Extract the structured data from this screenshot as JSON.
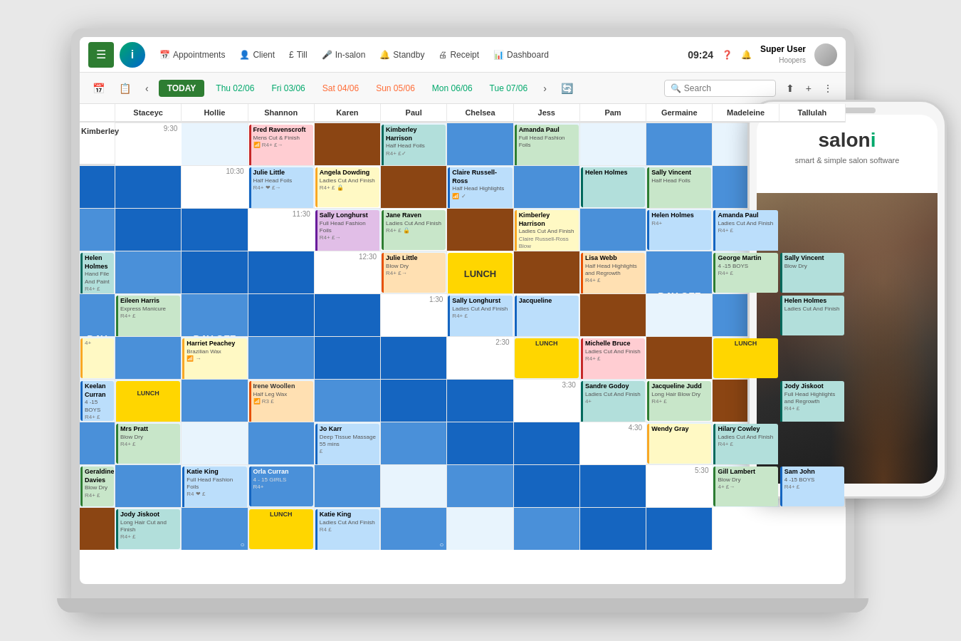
{
  "app": {
    "title": "Salon i",
    "tagline": "smart & simple salon software"
  },
  "nav": {
    "hamburger": "☰",
    "logo": "i",
    "items": [
      {
        "label": "Appointments",
        "icon": "📅"
      },
      {
        "label": "Client",
        "icon": "👤"
      },
      {
        "label": "Till",
        "icon": "£"
      },
      {
        "label": "In-salon",
        "icon": "🎤"
      },
      {
        "label": "Standby",
        "icon": "🔔"
      },
      {
        "label": "Receipt",
        "icon": "🖨"
      },
      {
        "label": "Dashboard",
        "icon": "📊"
      }
    ],
    "time": "09:24",
    "user_name": "Super User",
    "user_location": "Hoopers"
  },
  "toolbar": {
    "today_label": "TODAY",
    "dates": [
      "Thu 02/06",
      "Fri 03/06",
      "Sat 04/06",
      "Sun 05/06",
      "Mon 06/06",
      "Tue 07/06"
    ],
    "search_placeholder": "Search"
  },
  "calendar": {
    "columns": [
      "Staceyc",
      "Hollie",
      "Shannon",
      "Karen",
      "Paul",
      "Chelsea",
      "Jess",
      "Pam",
      "Germaine",
      "Madeleine",
      "Tallulah",
      "Kimberley"
    ],
    "time_slots": [
      "9:30",
      "10:30",
      "11:30",
      "12:30",
      "1:30",
      "2:30",
      "3:30",
      "4:30",
      "5:30"
    ]
  }
}
